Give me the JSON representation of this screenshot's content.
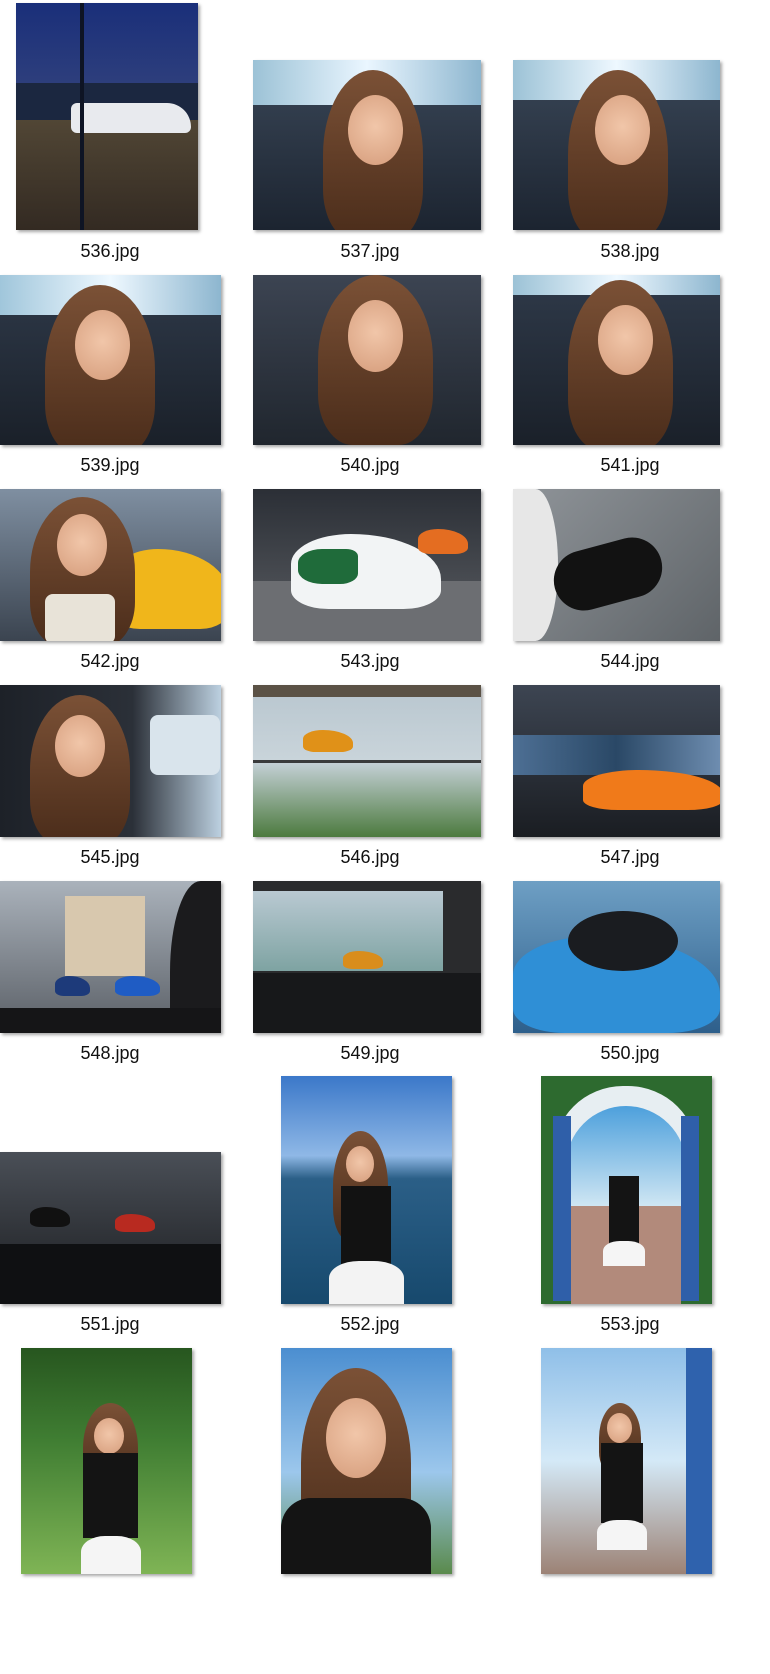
{
  "files": [
    {
      "name": "536.jpg"
    },
    {
      "name": "537.jpg"
    },
    {
      "name": "538.jpg"
    },
    {
      "name": "539.jpg"
    },
    {
      "name": "540.jpg"
    },
    {
      "name": "541.jpg"
    },
    {
      "name": "542.jpg"
    },
    {
      "name": "543.jpg"
    },
    {
      "name": "544.jpg"
    },
    {
      "name": "545.jpg"
    },
    {
      "name": "546.jpg"
    },
    {
      "name": "547.jpg"
    },
    {
      "name": "548.jpg"
    },
    {
      "name": "549.jpg"
    },
    {
      "name": "550.jpg"
    },
    {
      "name": "551.jpg"
    },
    {
      "name": "552.jpg"
    },
    {
      "name": "553.jpg"
    }
  ]
}
